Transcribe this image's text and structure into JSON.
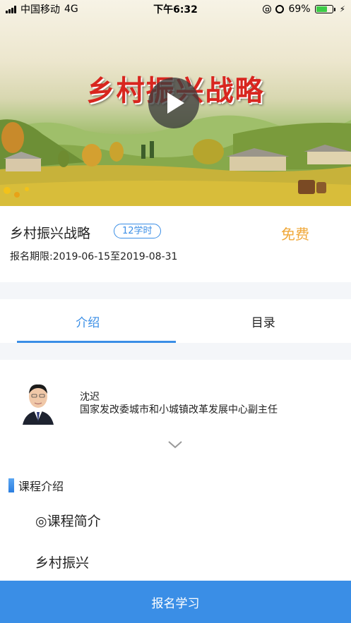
{
  "status_bar": {
    "carrier": "中国移动",
    "network": "4G",
    "time": "下午6:32",
    "battery": "69%",
    "battery_level": 0.69
  },
  "banner": {
    "title": "乡村振兴战略"
  },
  "course": {
    "title": "乡村振兴战略",
    "hours_badge": "12学时",
    "price": "免费",
    "enroll_period": "报名期限:2019-06-15至2019-08-31"
  },
  "tabs": [
    {
      "label": "介绍",
      "active": true
    },
    {
      "label": "目录",
      "active": false
    }
  ],
  "lecturer": {
    "name": "沈迟",
    "title": "国家发改委城市和小城镇改革发展中心副主任"
  },
  "intro": {
    "section_title": "课程介绍",
    "lines": [
      "◎课程简介",
      "乡村振兴"
    ]
  },
  "bottom": {
    "enroll_button": "报名学习"
  },
  "colors": {
    "accent": "#3a8ee6",
    "price": "#f0a83a"
  }
}
